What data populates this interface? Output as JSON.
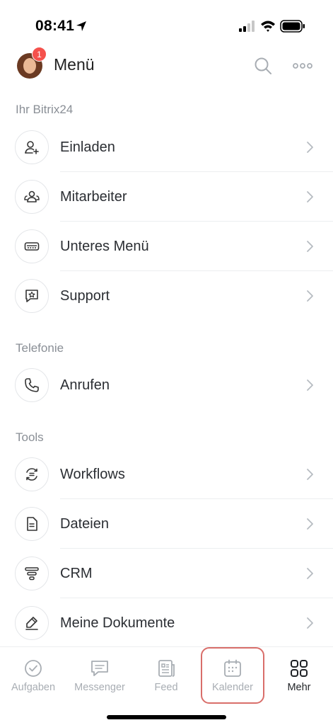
{
  "status_bar": {
    "time": "08:41"
  },
  "header": {
    "title": "Menü",
    "badge_count": "1"
  },
  "sections": {
    "bitrix": {
      "title": "Ihr Bitrix24"
    },
    "telefonie": {
      "title": "Telefonie"
    },
    "tools": {
      "title": "Tools"
    }
  },
  "items": {
    "einladen": "Einladen",
    "mitarbeiter": "Mitarbeiter",
    "unteres_menu": "Unteres Menü",
    "support": "Support",
    "anrufen": "Anrufen",
    "workflows": "Workflows",
    "dateien": "Dateien",
    "crm": "CRM",
    "meine_dokumente": "Meine Dokumente"
  },
  "tabbar": {
    "aufgaben": "Aufgaben",
    "messenger": "Messenger",
    "feed": "Feed",
    "kalender": "Kalender",
    "mehr": "Mehr",
    "active": "Mehr"
  },
  "colors": {
    "badge": "#f5514c",
    "highlight": "#d96e6a",
    "secondary_text": "#8a8f96"
  }
}
